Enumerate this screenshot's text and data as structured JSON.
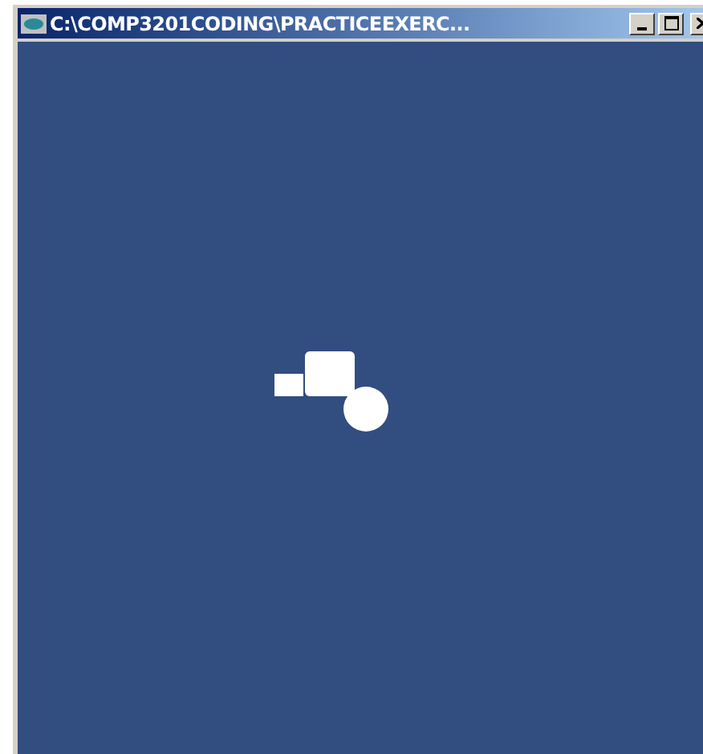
{
  "window": {
    "title": "C:\\COMP3201CODING\\PRACTICEEXERC..."
  }
}
